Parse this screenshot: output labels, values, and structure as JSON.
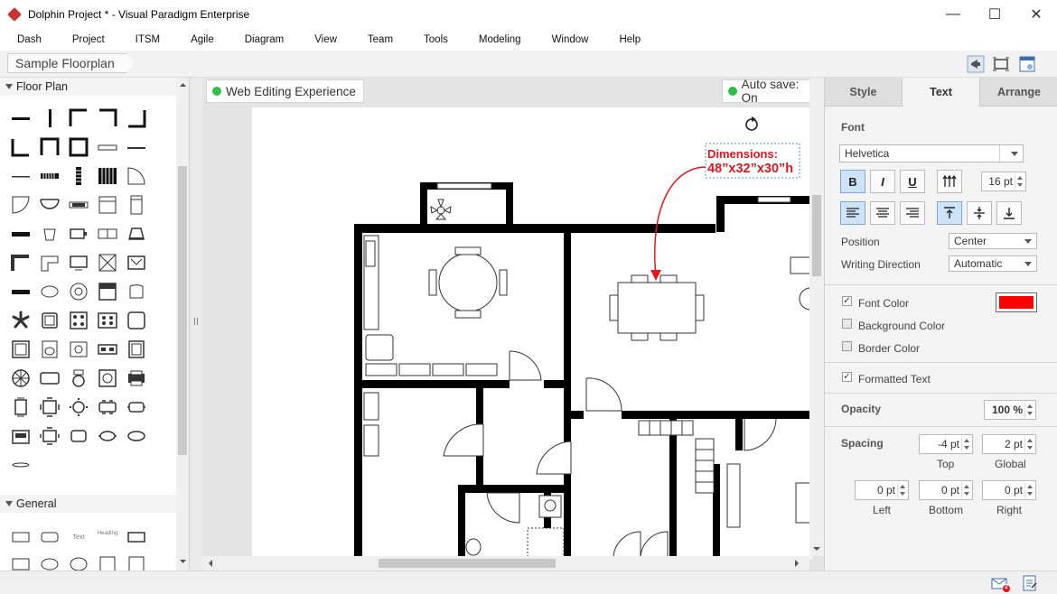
{
  "window": {
    "title": "Dolphin Project * - Visual Paradigm Enterprise",
    "minimize": "—",
    "maximize": "☐",
    "close": "✕"
  },
  "menu": [
    "Dash",
    "Project",
    "ITSM",
    "Agile",
    "Diagram",
    "View",
    "Team",
    "Tools",
    "Modeling",
    "Window",
    "Help"
  ],
  "breadcrumb": "Sample Floorplan",
  "palette": {
    "sections": [
      {
        "label": "Floor Plan"
      },
      {
        "label": "General"
      }
    ],
    "general_text_shape": "Text",
    "general_heading_shape": "Heading"
  },
  "canvas": {
    "mode_label": "Web Editing Experience",
    "autosave_label": "Auto save: On",
    "annotation_line1": "Dimensions:",
    "annotation_line2": "48”x32”x30”h"
  },
  "right_panel": {
    "tabs": [
      {
        "label": "Style"
      },
      {
        "label": "Text",
        "active": true
      },
      {
        "label": "Arrange"
      }
    ],
    "font_label": "Font",
    "font_value": "Helvetica",
    "bold": "B",
    "italic": "I",
    "underline": "U",
    "font_size": "16 pt",
    "position_label": "Position",
    "position_value": "Center",
    "writing_direction_label": "Writing Direction",
    "writing_direction_value": "Automatic",
    "font_color_label": "Font Color",
    "font_color": "#ff0000",
    "background_color_label": "Background Color",
    "border_color_label": "Border Color",
    "formatted_text_label": "Formatted Text",
    "opacity_label": "Opacity",
    "opacity_value": "100 %",
    "spacing_label": "Spacing",
    "spacing_top": "-4 pt",
    "spacing_top_label": "Top",
    "spacing_global": "2 pt",
    "spacing_global_label": "Global",
    "spacing_left": "0 pt",
    "spacing_left_label": "Left",
    "spacing_bottom": "0 pt",
    "spacing_bottom_label": "Bottom",
    "spacing_right": "0 pt",
    "spacing_right_label": "Right"
  },
  "status": {
    "mail_badge": "2"
  },
  "colors": {
    "accent_blue": "#cfe3f8",
    "status_green": "#2ebd4b",
    "annotation_red": "#e8141c"
  }
}
